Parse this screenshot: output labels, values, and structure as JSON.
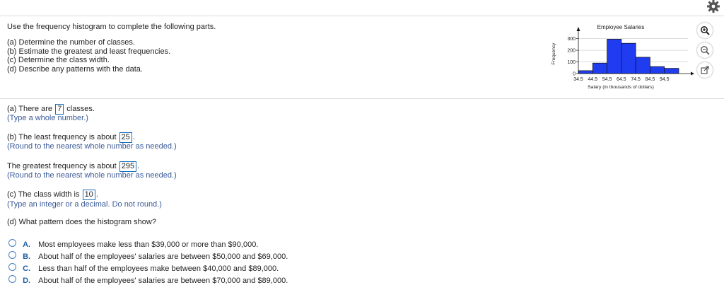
{
  "question": {
    "intro": "Use the frequency histogram to complete the following parts.",
    "parts": [
      "(a) Determine the number of classes.",
      "(b) Estimate the greatest and least frequencies.",
      "(c) Determine the class width.",
      "(d) Describe any patterns with the data."
    ]
  },
  "answers": {
    "a": {
      "prefix": "(a) There are",
      "value": "7",
      "suffix": "classes.",
      "hint": "(Type a whole number.)"
    },
    "b_least": {
      "prefix": "(b) The least frequency is about",
      "value": "25",
      "suffix": ".",
      "hint": "(Round to the nearest whole number as needed.)"
    },
    "b_greatest": {
      "prefix": "The greatest frequency is about",
      "value": "295",
      "suffix": ".",
      "hint": "(Round to the nearest whole number as needed.)"
    },
    "c": {
      "prefix": "(c) The class width is",
      "value": "10",
      "suffix": ".",
      "hint": "(Type an integer or a decimal. Do not round.)"
    },
    "d": {
      "question": "(d) What pattern does the histogram show?"
    }
  },
  "options": [
    {
      "letter": "A.",
      "text": "Most employees make less than $39,000 or more than $90,000."
    },
    {
      "letter": "B.",
      "text": "About half of the employees' salaries are between $50,000 and $69,000."
    },
    {
      "letter": "C.",
      "text": "Less than half of the employees make between $40,000 and $89,000."
    },
    {
      "letter": "D.",
      "text": "About half of the employees' salaries are between $70,000 and $89,000."
    }
  ],
  "icons": [
    "gear-icon",
    "zoom-in-icon",
    "zoom-out-icon",
    "popout-icon"
  ],
  "chart_data": {
    "type": "bar",
    "title": "Employee Salaries",
    "xlabel": "Salary (in thousands of dollars)",
    "ylabel": "Frequency",
    "categories": [
      "34.5",
      "44.5",
      "54.5",
      "64.5",
      "74.5",
      "84.5",
      "94.5"
    ],
    "bin_edges": [
      34.5,
      44.5,
      54.5,
      64.5,
      74.5,
      84.5,
      94.5,
      104.5
    ],
    "values": [
      25,
      90,
      295,
      260,
      140,
      60,
      45
    ],
    "yticks": [
      0,
      100,
      200,
      300
    ],
    "ylim": [
      0,
      340
    ],
    "bar_color": "#1f3cf0"
  }
}
